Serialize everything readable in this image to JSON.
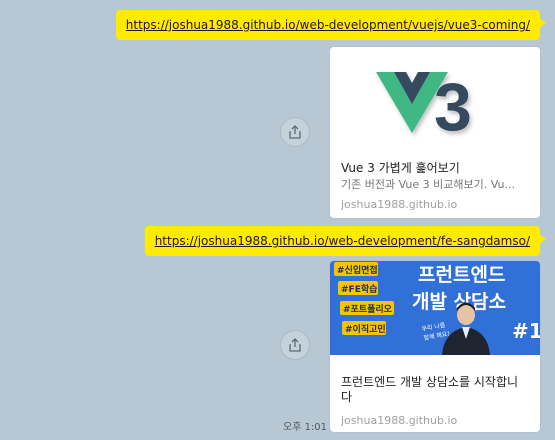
{
  "messages": [
    {
      "link_text": "https://joshua1988.github.io/web-development/vuejs/vue3-coming/",
      "preview": {
        "image_label": "V3",
        "title": "Vue 3 가볍게 훑어보기",
        "description": "기존 버전과 Vue 3 비교해보기. Vu...",
        "domain": "joshua1988.github.io"
      }
    },
    {
      "link_text": "https://joshua1988.github.io/web-development/fe-sangdamso/",
      "preview": {
        "image_tags": [
          "#신입면접",
          "#FE학습",
          "#포트폴리오",
          "#이직고민"
        ],
        "image_headline_1": "프런트엔드",
        "image_headline_2": "개발 상담소",
        "image_number": "#1",
        "image_sign_1": "우리 나름",
        "image_sign_2": "함께 해요!",
        "title": "프런트엔드 개발 상담소를 시작합니다",
        "domain": "joshua1988.github.io"
      }
    }
  ],
  "timestamp": "오후 1:01",
  "colors": {
    "background": "#b7c8d4",
    "bubble": "#ffeb00",
    "vue_green": "#41b883",
    "vue_dark": "#35495e",
    "banner_blue": "#2b6ad3",
    "tag_yellow": "#f6c400"
  },
  "icons": {
    "share": "share-icon"
  }
}
